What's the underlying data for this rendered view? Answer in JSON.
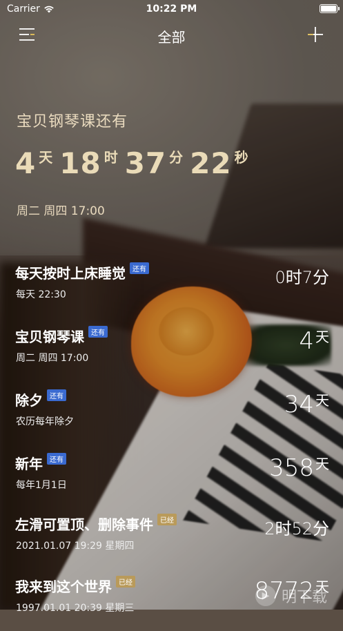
{
  "status_bar": {
    "carrier": "Carrier",
    "time": "10:22 PM"
  },
  "nav": {
    "title": "全部",
    "menu_icon": "menu-icon",
    "add_icon": "plus-icon"
  },
  "hero": {
    "title": "宝贝钢琴课还有",
    "days": "4",
    "days_unit": "天",
    "hours": "18",
    "hours_unit": "时",
    "minutes": "37",
    "minutes_unit": "分",
    "seconds": "22",
    "seconds_unit": "秒",
    "schedule": "周二 周四 17:00"
  },
  "events": [
    {
      "name": "每天按时上床睡觉",
      "badge": "还有",
      "badge_color": "#3a6ad0",
      "meta": "每天 22:30",
      "value": "0时7分",
      "unit": ""
    },
    {
      "name": "宝贝钢琴课",
      "badge": "还有",
      "badge_color": "#3a6ad0",
      "meta": "周二 周四 17:00",
      "value": "4",
      "unit": "天"
    },
    {
      "name": "除夕",
      "badge": "还有",
      "badge_color": "#3a6ad0",
      "meta": "农历每年除夕",
      "value": "34",
      "unit": "天"
    },
    {
      "name": "新年",
      "badge": "还有",
      "badge_color": "#3a6ad0",
      "meta": "每年1月1日",
      "value": "358",
      "unit": "天"
    },
    {
      "name": "左滑可置顶、删除事件",
      "badge": "已经",
      "badge_color": "#b99a5a",
      "meta": "2021.01.07 19:29 星期四",
      "value": "2时52分",
      "unit": ""
    },
    {
      "name": "我来到这个世界",
      "badge": "已经",
      "badge_color": "#b99a5a",
      "meta": "1997.01.01 20:39 星期三",
      "value": "8772",
      "unit": "天"
    }
  ],
  "watermark": {
    "text": "明下载"
  },
  "colors": {
    "hero_text": "#eadbbf",
    "badge_future": "#3a6ad0",
    "badge_past": "#b99a5a",
    "accent_plus": "#e6c35a"
  }
}
